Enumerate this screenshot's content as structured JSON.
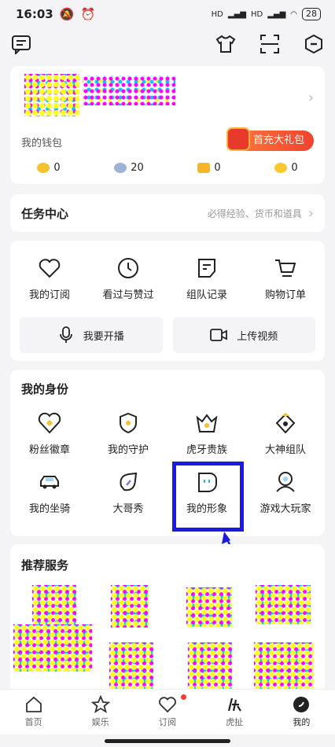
{
  "status": {
    "time": "16:03",
    "battery": "28",
    "net1": "HD",
    "net2": "HD"
  },
  "profile": {
    "wallet_label": "我的钱包",
    "promo": "首充大礼包",
    "balances": [
      {
        "icon": "gold-coin-icon",
        "value": "0"
      },
      {
        "icon": "silver-bean-icon",
        "value": "20"
      },
      {
        "icon": "gold-bean-icon",
        "value": "0"
      },
      {
        "icon": "coupon-icon",
        "value": "0"
      }
    ]
  },
  "task": {
    "title": "任务中心",
    "subtitle": "必得经验、货币和道具"
  },
  "shortcuts": [
    {
      "icon": "heart-icon",
      "label": "我的订阅"
    },
    {
      "icon": "clock-icon",
      "label": "看过与赞过"
    },
    {
      "icon": "note-icon",
      "label": "组队记录"
    },
    {
      "icon": "cart-icon",
      "label": "购物订单"
    }
  ],
  "buttons": {
    "live": "我要开播",
    "upload": "上传视频"
  },
  "identity": {
    "title": "我的身份",
    "row1": [
      {
        "icon": "fan-badge-icon",
        "label": "粉丝徽章"
      },
      {
        "icon": "guard-icon",
        "label": "我的守护"
      },
      {
        "icon": "crown-icon",
        "label": "虎牙贵族"
      },
      {
        "icon": "god-team-icon",
        "label": "大神组队"
      }
    ],
    "row2": [
      {
        "icon": "car-icon",
        "label": "我的坐骑"
      },
      {
        "icon": "big-brother-icon",
        "label": "大哥秀"
      },
      {
        "icon": "avatar-icon",
        "label": "我的形象"
      },
      {
        "icon": "player-icon",
        "label": "游戏大玩家"
      }
    ]
  },
  "recommend": {
    "title": "推荐服务"
  },
  "tabs": [
    {
      "icon": "home-icon",
      "label": "首页"
    },
    {
      "icon": "star-icon",
      "label": "娱乐"
    },
    {
      "icon": "heart-icon",
      "label": "订阅"
    },
    {
      "icon": "huya-icon",
      "label": "虎扯"
    },
    {
      "icon": "me-icon",
      "label": "我的"
    }
  ],
  "colors": {
    "highlight": "#1a1ae0",
    "accent": "#f0422e"
  }
}
